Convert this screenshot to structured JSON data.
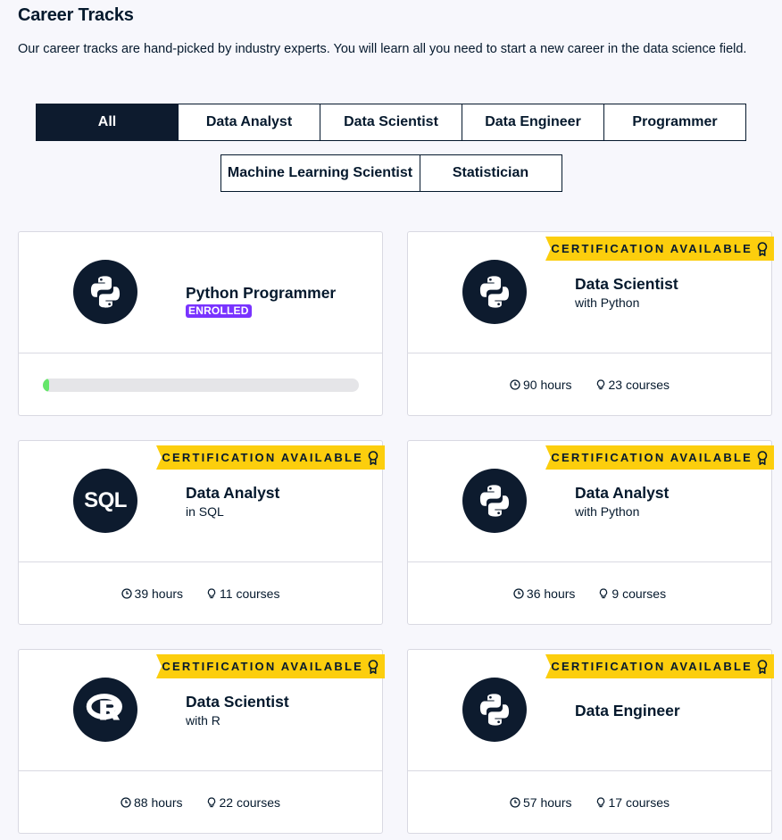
{
  "header": {
    "title": "Career Tracks",
    "description": "Our career tracks are hand-picked by industry experts. You will learn all you need to start a new career in the data science field."
  },
  "filters": [
    {
      "label": "All",
      "active": true
    },
    {
      "label": "Data Analyst",
      "active": false
    },
    {
      "label": "Data Scientist",
      "active": false
    },
    {
      "label": "Data Engineer",
      "active": false
    },
    {
      "label": "Programmer",
      "active": false
    },
    {
      "label": "Machine Learning Scientist",
      "active": false
    },
    {
      "label": "Statistician",
      "active": false
    }
  ],
  "colors": {
    "navy": "#05192d",
    "enrolled_badge": "#7933ff",
    "cert_banner": "#fcce0d",
    "progress_fill": "#65e66a"
  },
  "cards": [
    {
      "title": "Python Programmer",
      "subtitle": "",
      "logo": "python-logo-icon",
      "badge": "ENROLLED",
      "progress_percent": 1,
      "certification": null
    },
    {
      "title": "Data Scientist",
      "subtitle": "with Python",
      "logo": "python-logo-icon",
      "certification": "CERTIFICATION AVAILABLE",
      "hours": "90 hours",
      "courses": "23 courses"
    },
    {
      "title": "Data Analyst",
      "subtitle": "in SQL",
      "logo": "sql-logo-icon",
      "logo_text": "SQL",
      "certification": "CERTIFICATION AVAILABLE",
      "hours": "39 hours",
      "courses": "11 courses"
    },
    {
      "title": "Data Analyst",
      "subtitle": "with Python",
      "logo": "python-logo-icon",
      "certification": "CERTIFICATION AVAILABLE",
      "hours": "36 hours",
      "courses": "9 courses"
    },
    {
      "title": "Data Scientist",
      "subtitle": "with R",
      "logo": "r-logo-icon",
      "certification": "CERTIFICATION AVAILABLE",
      "hours": "88 hours",
      "courses": "22 courses"
    },
    {
      "title": "Data Engineer",
      "subtitle": "",
      "logo": "python-logo-icon",
      "certification": "CERTIFICATION AVAILABLE",
      "hours": "57 hours",
      "courses": "17 courses"
    }
  ]
}
